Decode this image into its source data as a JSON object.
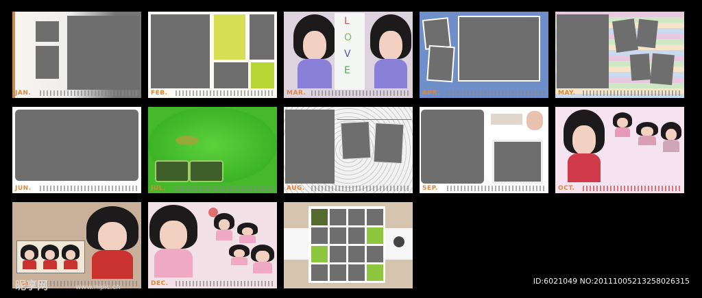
{
  "months": [
    "JAN.",
    "FEB.",
    "MAR.",
    "APR.",
    "MAY.",
    "JUN.",
    "JUL.",
    "AUG.",
    "SEP.",
    "OCT.",
    "NOV.",
    "DEC."
  ],
  "love_letters": [
    "L",
    "O",
    "V",
    "E"
  ],
  "watermark": "ID:6021049 NO:20111005213258026315",
  "logo": "昵享网",
  "logo_url": "www.nipic.cn"
}
